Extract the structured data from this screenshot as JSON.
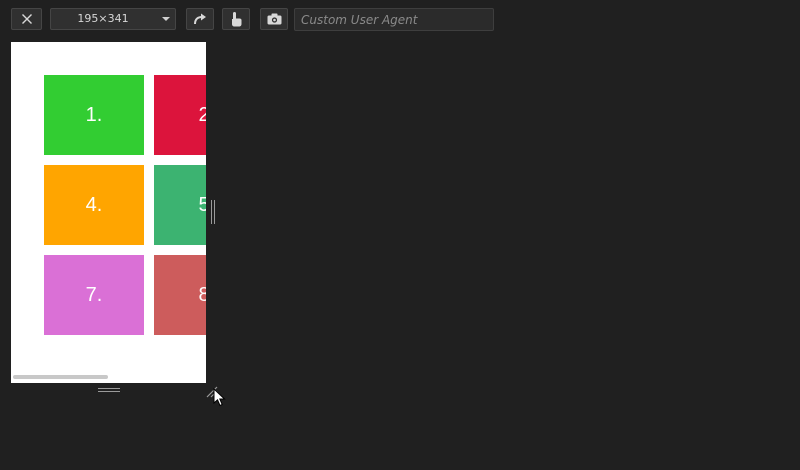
{
  "toolbar": {
    "size_value": "195×341",
    "user_agent_placeholder": "Custom User Agent",
    "icons": {
      "close": "close-icon",
      "rotate": "rotate-icon",
      "touch": "touch-icon",
      "screenshot": "camera-icon"
    }
  },
  "viewport": {
    "tiles": [
      {
        "label": "1.",
        "color": "#32cd32"
      },
      {
        "label": "2",
        "color": "#dc143c"
      },
      {
        "label": "4.",
        "color": "#ffa500"
      },
      {
        "label": "5",
        "color": "#3cb371"
      },
      {
        "label": "7.",
        "color": "#da70d6"
      },
      {
        "label": "8",
        "color": "#cd5c5c"
      }
    ]
  },
  "colors": {
    "background": "#202020",
    "control": "#303030",
    "viewport_bg": "#ffffff"
  }
}
